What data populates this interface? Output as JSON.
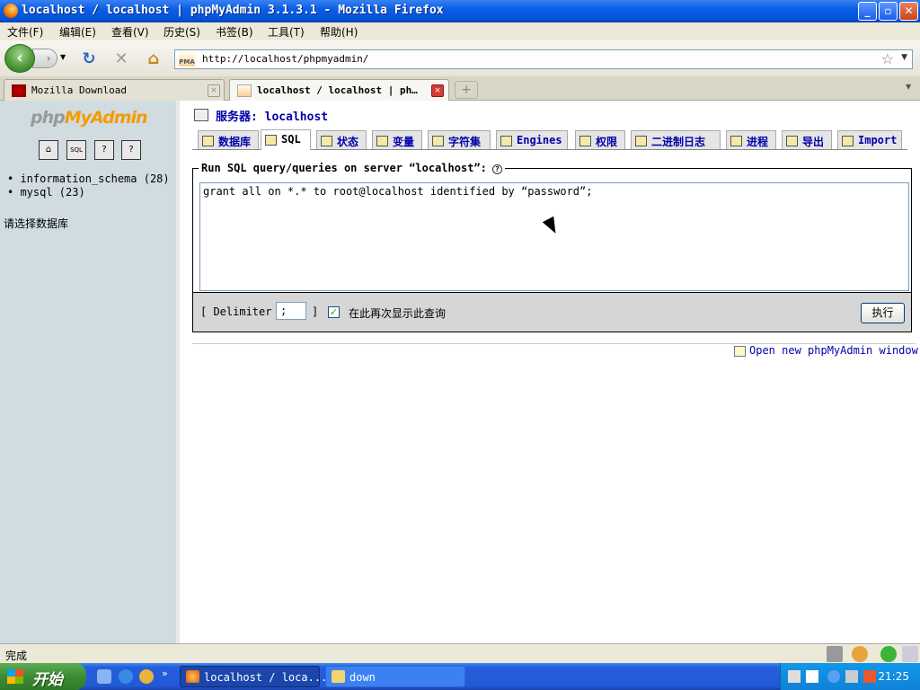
{
  "window": {
    "title": "localhost / localhost | phpMyAdmin 3.1.3.1 - Mozilla Firefox"
  },
  "menubar": {
    "items": [
      "文件(F)",
      "编辑(E)",
      "查看(V)",
      "历史(S)",
      "书签(B)",
      "工具(T)",
      "帮助(H)"
    ]
  },
  "navbar": {
    "url": "http://localhost/phpmyadmin/",
    "site_icon_text": "PMA"
  },
  "tabs": [
    {
      "label": "Mozilla Download",
      "active": false
    },
    {
      "label": "localhost / localhost | ph…",
      "active": true
    }
  ],
  "left": {
    "logo_a": "php",
    "logo_b": "MyAdmin",
    "databases": [
      "information_schema (28)",
      "mysql (23)"
    ],
    "choose_db": "请选择数据库",
    "buttons": [
      "home",
      "sql",
      "query",
      "docs"
    ]
  },
  "main": {
    "server_label": "服务器: localhost",
    "tabs": [
      "数据库",
      "SQL",
      "状态",
      "变量",
      "字符集",
      "Engines",
      "权限",
      "二进制日志",
      "进程",
      "导出",
      "Import"
    ],
    "active_tab": "SQL",
    "legend": "Run SQL query/queries on server “localhost”:",
    "query": "grant all on *.* to root@localhost identified by “password”;",
    "delimiter_label": "[ Delimiter",
    "delimiter_value": ";",
    "delimiter_close": "]",
    "show_again_label": "在此再次显示此查询",
    "show_again_checked": true,
    "go_button": "执行",
    "new_window_link": "Open new phpMyAdmin window"
  },
  "statusbar": {
    "text": "完成"
  },
  "taskbar": {
    "start": "开始",
    "tasks": [
      "localhost / loca...",
      "down"
    ],
    "clock": "21:25"
  },
  "colors": {
    "link": "#0000aa",
    "left_frame": "#d0dce0",
    "title_bar": "#0a5fe6"
  }
}
